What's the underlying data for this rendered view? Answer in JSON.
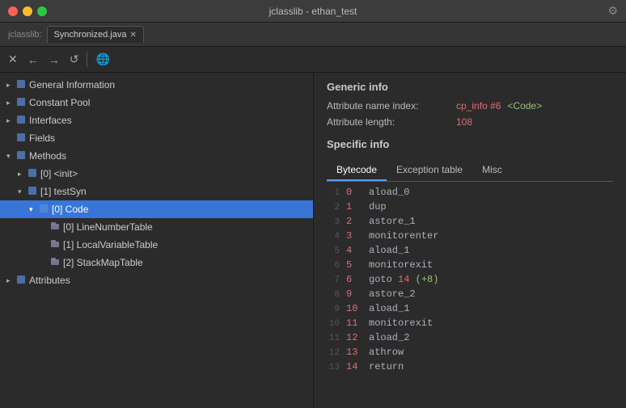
{
  "window": {
    "title": "jclasslib - ethan_test",
    "app_label": "jclasslib:",
    "tab_name": "Synchronized.java"
  },
  "toolbar": {
    "close_label": "✕",
    "back_label": "←",
    "forward_label": "→",
    "reload_label": "↺",
    "home_label": "⌂"
  },
  "tree": {
    "items": [
      {
        "id": "general",
        "label": "General Information",
        "level": 0,
        "arrow": "▸",
        "icon": "🗒",
        "expanded": false,
        "selected": false
      },
      {
        "id": "constant-pool",
        "label": "Constant Pool",
        "level": 0,
        "arrow": "▸",
        "icon": "📋",
        "expanded": false,
        "selected": false
      },
      {
        "id": "interfaces",
        "label": "Interfaces",
        "level": 0,
        "arrow": "▸",
        "icon": "📋",
        "expanded": false,
        "selected": false
      },
      {
        "id": "fields",
        "label": "Fields",
        "level": 0,
        "arrow": "",
        "icon": "📋",
        "expanded": false,
        "selected": false
      },
      {
        "id": "methods",
        "label": "Methods",
        "level": 0,
        "arrow": "▾",
        "icon": "📁",
        "expanded": true,
        "selected": false
      },
      {
        "id": "init",
        "label": "[0] <init>",
        "level": 1,
        "arrow": "▸",
        "icon": "📁",
        "expanded": false,
        "selected": false
      },
      {
        "id": "testSyn",
        "label": "[1] testSyn",
        "level": 1,
        "arrow": "▾",
        "icon": "📁",
        "expanded": true,
        "selected": false
      },
      {
        "id": "code",
        "label": "[0] Code",
        "level": 2,
        "arrow": "▾",
        "icon": "📁",
        "expanded": true,
        "selected": true
      },
      {
        "id": "lineNumberTable",
        "label": "[0] LineNumberTable",
        "level": 3,
        "arrow": "",
        "icon": "📄",
        "expanded": false,
        "selected": false
      },
      {
        "id": "localVariableTable",
        "label": "[1] LocalVariableTable",
        "level": 3,
        "arrow": "",
        "icon": "📄",
        "expanded": false,
        "selected": false
      },
      {
        "id": "stackMapTable",
        "label": "[2] StackMapTable",
        "level": 3,
        "arrow": "",
        "icon": "📄",
        "expanded": false,
        "selected": false
      },
      {
        "id": "attributes",
        "label": "Attributes",
        "level": 0,
        "arrow": "▸",
        "icon": "📁",
        "expanded": false,
        "selected": false
      }
    ]
  },
  "content": {
    "generic_info_title": "Generic info",
    "attribute_name_label": "Attribute name index:",
    "attribute_name_value": "cp_info #6",
    "attribute_name_suffix": "<Code>",
    "attribute_length_label": "Attribute length:",
    "attribute_length_value": "108",
    "specific_info_title": "Specific info",
    "tabs": [
      "Bytecode",
      "Exception table",
      "Misc"
    ],
    "active_tab": "Bytecode"
  },
  "bytecode": [
    {
      "line": 1,
      "num": 0,
      "instr": "aload_0",
      "extra": ""
    },
    {
      "line": 2,
      "num": 1,
      "instr": "dup",
      "extra": ""
    },
    {
      "line": 3,
      "num": 2,
      "instr": "astore_1",
      "extra": ""
    },
    {
      "line": 4,
      "num": 3,
      "instr": "monitorenter",
      "extra": ""
    },
    {
      "line": 5,
      "num": 4,
      "instr": "aload_1",
      "extra": ""
    },
    {
      "line": 6,
      "num": 5,
      "instr": "monitorexit",
      "extra": ""
    },
    {
      "line": 7,
      "num": 6,
      "instr": "goto",
      "target": "14",
      "offset": "(+8)",
      "extra": "goto"
    },
    {
      "line": 8,
      "num": 9,
      "instr": "astore_2",
      "extra": ""
    },
    {
      "line": 9,
      "num": 10,
      "instr": "aload_1",
      "extra": ""
    },
    {
      "line": 10,
      "num": 11,
      "instr": "monitorexit",
      "extra": ""
    },
    {
      "line": 11,
      "num": 12,
      "instr": "aload_2",
      "extra": ""
    },
    {
      "line": 12,
      "num": 13,
      "instr": "athrow",
      "extra": ""
    },
    {
      "line": 13,
      "num": 14,
      "instr": "return",
      "extra": ""
    }
  ]
}
